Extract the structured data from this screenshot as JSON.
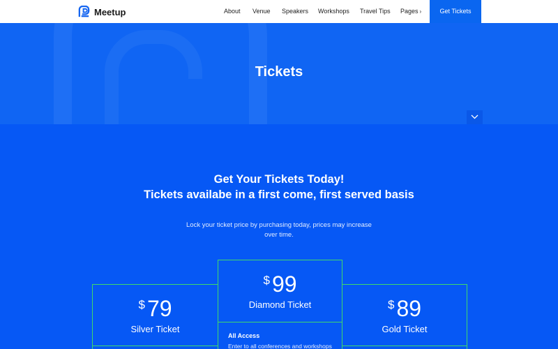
{
  "header": {
    "brand": "Meetup",
    "nav": [
      {
        "label": "About"
      },
      {
        "label": "Venue"
      },
      {
        "label": "Speakers"
      },
      {
        "label": "Workshops"
      },
      {
        "label": "Travel Tips"
      },
      {
        "label": "Pages"
      }
    ],
    "cta_label": "Get Tickets"
  },
  "hero": {
    "title": "Tickets"
  },
  "section": {
    "heading_line1": "Get Your Tickets Today!",
    "heading_line2": "Tickets availabe in a first come, first served basis",
    "subtext": "Lock your ticket price by purchasing today, prices may increase over time."
  },
  "tickets": [
    {
      "currency": "$",
      "price": "79",
      "name": "Silver Ticket"
    },
    {
      "currency": "$",
      "price": "99",
      "name": "Diamond Ticket",
      "feature_title": "All Access",
      "feature_desc": "Enter to all conferences and workshops"
    },
    {
      "currency": "$",
      "price": "89",
      "name": "Gold Ticket"
    }
  ],
  "colors": {
    "accent": "#0658f5",
    "card_border": "#3fd96a"
  }
}
